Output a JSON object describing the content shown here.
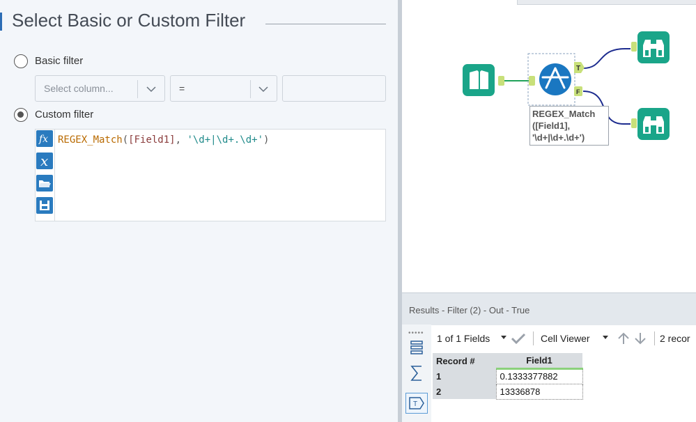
{
  "config_panel": {
    "title": "Select Basic or Custom Filter",
    "basic_filter_label": "Basic filter",
    "basic_filter_selected": false,
    "column_select_placeholder": "Select column...",
    "operator_value": "=",
    "value_input": "",
    "custom_filter_label": "Custom filter",
    "custom_filter_selected": true,
    "expression": {
      "function": "REGEX_Match",
      "open": "(",
      "field": "[Field1]",
      "comma": ", ",
      "pattern": "'\\d+|\\d+.\\d+'",
      "close": ")"
    },
    "editor_tools": [
      "fx-function-icon",
      "x-variable-icon",
      "open-folder-icon",
      "save-icon"
    ]
  },
  "canvas": {
    "filter_tool_label": [
      "REGEX_Match",
      "([Field1],",
      "'\\d+|\\d+.\\d+')"
    ],
    "true_anchor": "T",
    "false_anchor": "F",
    "colors": {
      "tool_green": "#1aa589",
      "filter_blue": "#1a77c1",
      "connection_true_false": "#1d2c8f",
      "connection_input": "#21a35a",
      "anchor": "#c8e07a"
    }
  },
  "results": {
    "title": "Results - Filter (2) - Out - True",
    "fields_selector": "1 of 1 Fields",
    "viewer_selector": "Cell Viewer",
    "record_count": "2 recor",
    "columns": [
      "Record #",
      "Field1"
    ],
    "rows": [
      {
        "record": "1",
        "field1": "0.1333377882"
      },
      {
        "record": "2",
        "field1": "13336878"
      }
    ]
  }
}
